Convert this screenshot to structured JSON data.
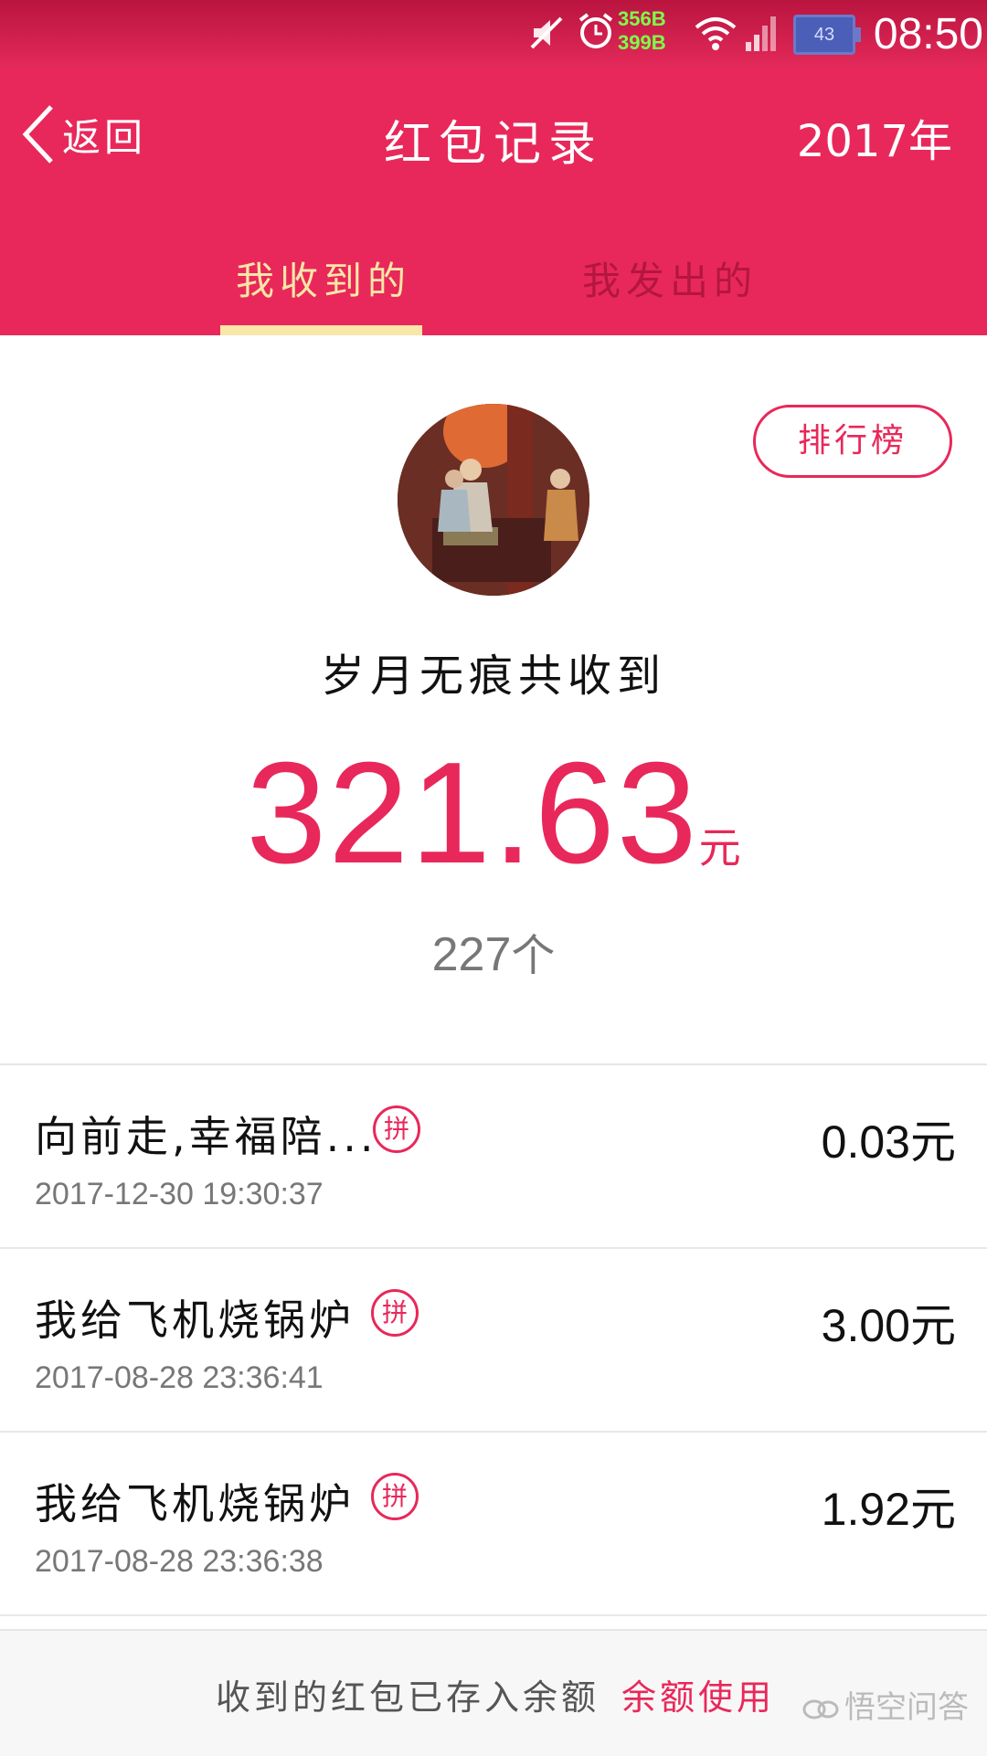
{
  "status_bar": {
    "time": "08:50",
    "net_up": "356B",
    "net_down": "399B",
    "battery": "43",
    "icons": [
      "mute-icon",
      "alarm-icon",
      "wifi-icon",
      "signal-icon",
      "battery-icon"
    ]
  },
  "header": {
    "back_label": "返回",
    "title": "红包记录",
    "year": "2017年"
  },
  "tabs": [
    {
      "label": "我收到的",
      "active": true
    },
    {
      "label": "我发出的",
      "active": false
    }
  ],
  "summary": {
    "rank_button": "排行榜",
    "name_line": "岁月无痕共收到",
    "total_amount": "321.63",
    "currency": "元",
    "count": "227",
    "count_unit": "个"
  },
  "records": [
    {
      "name": "向前走,幸福陪...",
      "badge": "拼",
      "time": "2017-12-30 19:30:37",
      "amount": "0.03",
      "unit": "元"
    },
    {
      "name": "我给飞机烧锅炉",
      "badge": "拼",
      "time": "2017-08-28 23:36:41",
      "amount": "3.00",
      "unit": "元"
    },
    {
      "name": "我给飞机烧锅炉",
      "badge": "拼",
      "time": "2017-08-28 23:36:38",
      "amount": "1.92",
      "unit": "元"
    }
  ],
  "footer": {
    "text": "收到的红包已存入余额",
    "link": "余额使用",
    "watermark": "悟空问答"
  },
  "colors": {
    "brand_red": "#e8285a",
    "tab_active": "#f9e6a8",
    "tab_inactive": "#b31640"
  }
}
